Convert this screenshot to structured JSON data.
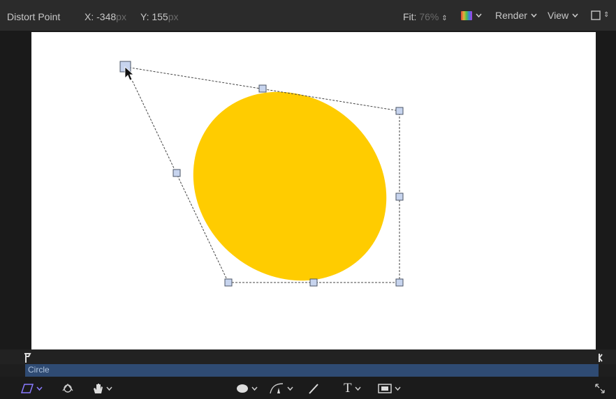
{
  "header": {
    "tool_name": "Distort Point",
    "x_label": "X:",
    "x_value": "-348",
    "x_unit": "px",
    "y_label": "Y:",
    "y_value": "155",
    "y_unit": "px",
    "fit_label": "Fit:",
    "fit_value": "76%",
    "render_label": "Render",
    "view_label": "View"
  },
  "track": {
    "name": "Circle"
  },
  "colors": {
    "shape_fill": "#ffcc00",
    "selection_bar": "#2f4b73",
    "accent_tool": "#7b6cff"
  },
  "toolbar": {
    "icons": [
      "distort-tool-icon",
      "3d-transform-icon",
      "pan-hand-icon",
      "ellipse-shape-icon",
      "bezier-pen-icon",
      "paint-stroke-icon",
      "text-tool-icon",
      "mask-icon",
      "expand-icon"
    ],
    "text_tool_glyph": "T"
  }
}
